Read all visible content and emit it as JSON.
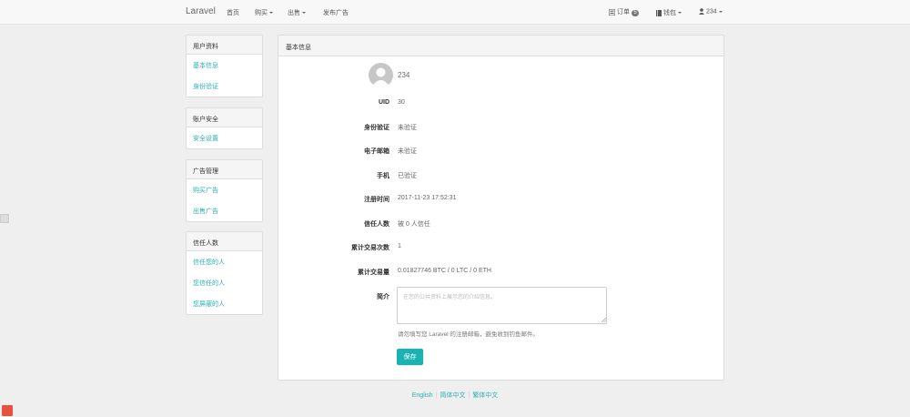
{
  "navbar": {
    "brand": "Laravel",
    "home": "首页",
    "buy": "购买",
    "sell": "出售",
    "post_ad": "发布广告",
    "orders": "订单",
    "orders_count": "5",
    "wallet": "钱包",
    "user": "234"
  },
  "sidebar": [
    {
      "title": "用户资料",
      "items": [
        "基本信息",
        "身份验证"
      ]
    },
    {
      "title": "账户安全",
      "items": [
        "安全设置"
      ]
    },
    {
      "title": "广告管理",
      "items": [
        "购买广告",
        "出售广告"
      ]
    },
    {
      "title": "信任人数",
      "items": [
        "信任您的人",
        "您信任的人",
        "您屏蔽的人"
      ]
    }
  ],
  "main": {
    "title": "基本信息",
    "username": "234",
    "fields": [
      {
        "label": "UID",
        "value": "30"
      },
      {
        "label": "身份验证",
        "value": "未验证"
      },
      {
        "label": "电子邮箱",
        "value": "未验证"
      },
      {
        "label": "手机",
        "value": "已验证"
      },
      {
        "label": "注册时间",
        "value": "2017-11-23 17:52:31"
      },
      {
        "label": "信任人数",
        "value": "被 0 人信任"
      },
      {
        "label": "累计交易次数",
        "value": "1"
      },
      {
        "label": "累计交易量",
        "value": "0.01827746 BTC / 0 LTC / 0 ETH"
      }
    ],
    "bio_label": "简介",
    "bio_placeholder": "在您的公共资料上展示您的介绍信息。",
    "hint": "请勿填写您 Laravel 的注册邮箱，避免收到钓鱼邮件。",
    "save": "保存"
  },
  "footer": {
    "english": "English",
    "simplified": "简体中文",
    "traditional": "繁体中文"
  },
  "colors": {
    "accent": "#1ab3b3",
    "link": "#2ab0b0"
  }
}
